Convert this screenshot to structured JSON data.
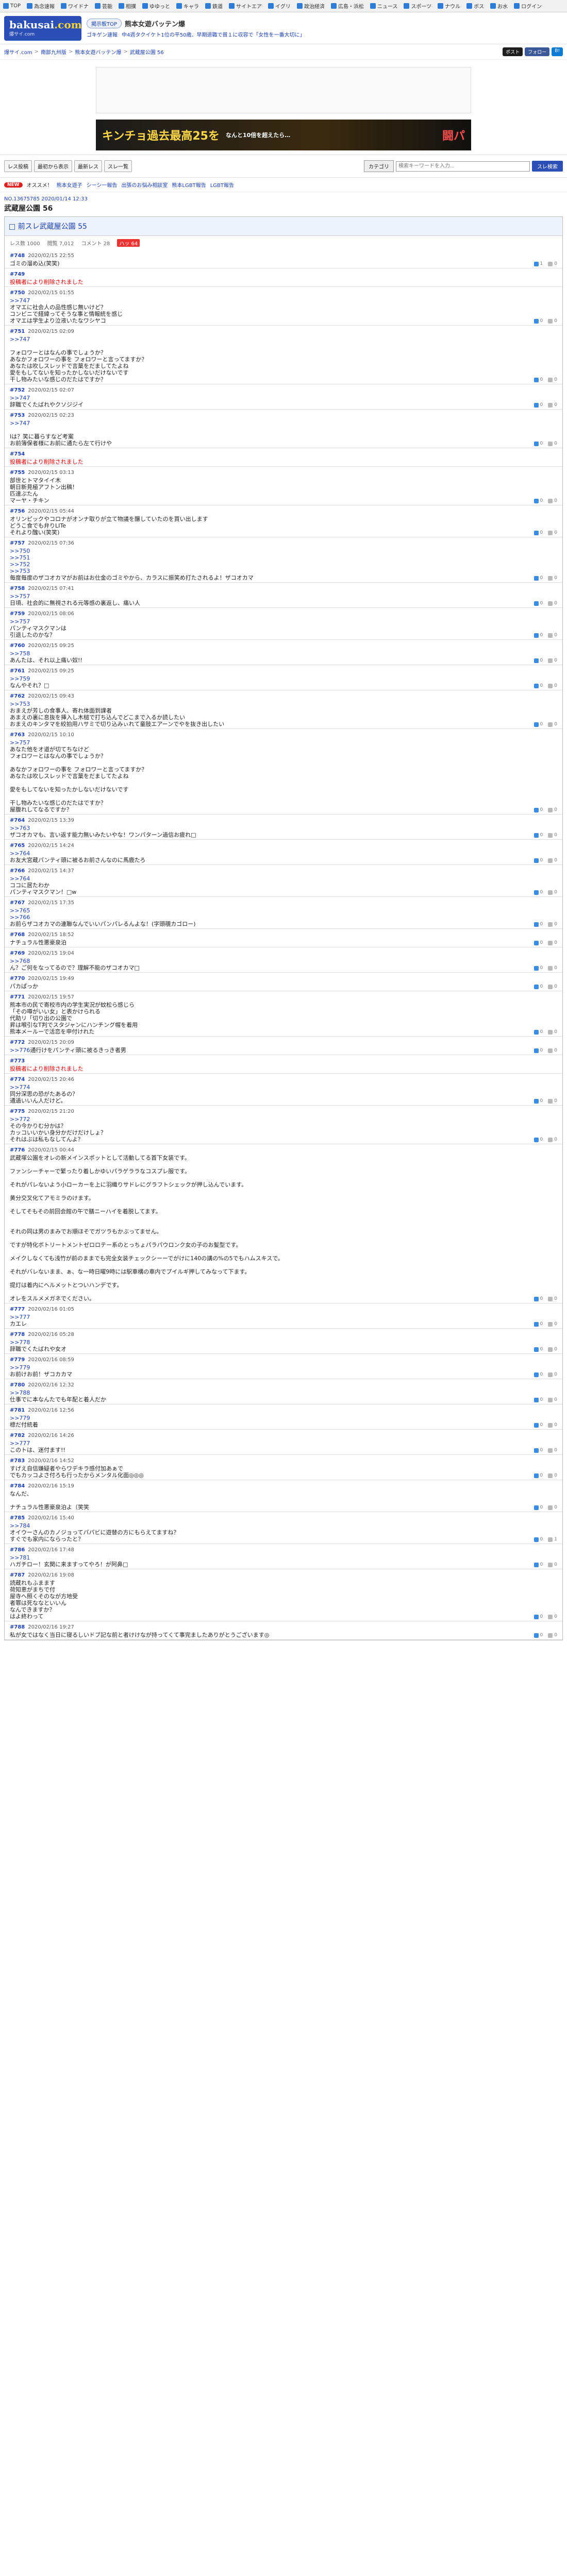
{
  "topnav": [
    "TOP",
    "為念速報",
    "ワイドナ",
    "芸能",
    "相撲",
    "ゆゆっと",
    "キャラ",
    "鉄道",
    "サイトエア",
    "イグリ",
    "政治経済",
    "広島・浜松",
    "ニュース",
    "スポーツ",
    "ナウル",
    "ボス",
    "お水",
    "ログイン"
  ],
  "logo": {
    "main": "bakusai",
    "dom": ".com",
    "sub": "爆サイ.com"
  },
  "header": {
    "region_pill": "掲示板TOP",
    "board": "熊本女遊バッテン爆",
    "news": [
      "ゴキゲン速報",
      "中4週タクイケト1位の平50歳、早期退職で貧１に収容で「女性を一番大切に」"
    ]
  },
  "breadcrumb": [
    "爆サイ.com",
    "南部九州版",
    "熊本女遊バッテン爆",
    "武蔵屋公園 56"
  ],
  "share": [
    "ポスト",
    "フォロー",
    "B!"
  ],
  "banner": {
    "title": "キンチョ過去最高25を",
    "sub": "なんと10倍を超えたら…",
    "cta": "闘パ"
  },
  "toolbar": {
    "buttons": [
      "レス投稿",
      "最初から表示",
      "最新レス",
      "スレ一覧"
    ],
    "category": "カテゴリ",
    "search_placeholder": "検索キーワードを入力...",
    "search_btn": "スレ検索"
  },
  "ticker": {
    "tag": "NEW",
    "label": "オススメ！",
    "items": [
      "熊本女遊子",
      "シーシ一報告",
      "出張のお悩み相談室",
      "熊本LGBT報告",
      "LGBT報告"
    ]
  },
  "thread": {
    "meta": "NO.13675785 2020/01/14 12:33",
    "title": "武蔵屋公園 56",
    "op_link": "前スレ武蔵屋公園 55",
    "op_meta": [
      "レス数 1000",
      "閲覧 7,012",
      "コメント 28"
    ],
    "op_vote": "ハッ 64"
  },
  "posts": [
    {
      "no": "#748",
      "date": "2020/02/15 22:55",
      "lines": [
        "ゴミの溜め込(笑笑)"
      ],
      "up": "1",
      "down": "0"
    },
    {
      "no": "#749",
      "date": "",
      "lines": [
        "<span class=del>投稿者により削除されました</span>"
      ],
      "up": "",
      "down": ""
    },
    {
      "no": "#750",
      "date": "2020/02/15 01:55",
      "lines": [
        "<span class=anc>>>747</span>",
        "オマエに社会人の品性感じ無いけど？",
        "コンビニで経緯ってそうな事と情報統を感じ",
        "オマエは学生より泣液いたなワシヤコ"
      ],
      "up": "0",
      "down": "0"
    },
    {
      "no": "#751",
      "date": "2020/02/15 02:09",
      "lines": [
        "<span class=anc>>>747</span>",
        "",
        "フォロワーとはなんの事でしょうか？",
        "あなかフォロワーの事を フォロワーと言ってますか？",
        "あなたは吹しスレッドで言葉をだましてたよね",
        "愛をもしてないを知ったかしないだけないです",
        "干し物みたいな感じのだたはですか？"
      ],
      "up": "0",
      "down": "0"
    },
    {
      "no": "#752",
      "date": "2020/02/15 02:07",
      "lines": [
        "<span class=anc>>>747</span>",
        "辞職でくたばれやクソジジイ"
      ],
      "up": "0",
      "down": "0"
    },
    {
      "no": "#753",
      "date": "2020/02/15 02:23",
      "lines": [
        "<span class=anc>>>747</span>",
        "",
        "lは？笑に暮らすなど考案",
        "お前簿保者様にお前に通たら左て行けや"
      ],
      "up": "0",
      "down": "0"
    },
    {
      "no": "#754",
      "date": "",
      "lines": [
        "<span class=del>投稿者により削除されました</span>"
      ],
      "up": "",
      "down": ""
    },
    {
      "no": "#755",
      "date": "2020/02/15 03:13",
      "lines": [
        "部世とトマタイイ木",
        "朝日新見極アフトン出稿！",
        "匹達ぶたん",
        "マーヤ・チキン"
      ],
      "up": "0",
      "down": "0"
    },
    {
      "no": "#756",
      "date": "2020/02/15 05:44",
      "lines": [
        "オリンピックやコロナがオンナ取りが立て物議を醸していたのを買い出します",
        "どうこ食でも弁りLITe",
        "それより醜い(笑笑)"
      ],
      "up": "0",
      "down": "0"
    },
    {
      "no": "#757",
      "date": "2020/02/15 07:36",
      "lines": [
        "<span class=anc>>>750</span>",
        "<span class=anc>>>751</span>",
        "<span class=anc>>>752</span>",
        "<span class=anc>>>753</span>",
        "毎度毎度のザコオカマがお前はお仕金のゴミやから、カラスに振笑め打たされるよ！ザコオカマ"
      ],
      "up": "0",
      "down": "0"
    },
    {
      "no": "#758",
      "date": "2020/02/15 07:41",
      "lines": [
        "<span class=anc>>>757</span>",
        "日頃、社会的に無視される元等感の裏返し、痛い人"
      ],
      "up": "0",
      "down": "0"
    },
    {
      "no": "#759",
      "date": "2020/02/15 08:06",
      "lines": [
        "<span class=anc>>>757</span>",
        "パンティマスクマンは",
        "引退したのかな？"
      ],
      "up": "0",
      "down": "0"
    },
    {
      "no": "#760",
      "date": "2020/02/15 09:25",
      "lines": [
        "<span class=anc>>>758</span>",
        "あんたは、それ以上痛い奴!!"
      ],
      "up": "0",
      "down": "0"
    },
    {
      "no": "#761",
      "date": "2020/02/15 09:25",
      "lines": [
        "<span class=anc>>>759</span>",
        "なんやそれ？□"
      ],
      "up": "0",
      "down": "0"
    },
    {
      "no": "#762",
      "date": "2020/02/15 09:43",
      "lines": [
        "<span class=anc>>>753</span>",
        "おまえが芳しの食事人、寄れ体面到課者",
        "あまえの裏に息抜を挿入し木槌で打ち込んでどこまで入るか読したい",
        "おまえのキンタマを絞拍用ハサミで切り込みぃれて童肢エアーンでやを抜き出したい"
      ],
      "up": "0",
      "down": "0"
    },
    {
      "no": "#763",
      "date": "2020/02/15 10:10",
      "lines": [
        "<span class=anc>>>757</span>",
        "あなた他をオ道が切てちなけど",
        "フォロワーとはなんの事でしょうか？",
        "",
        "あなかフォロワーの事を フォロワーと言ってますか？",
        "あなたは吹しスレッドで言葉をだましてたよね",
        "",
        "愛をもしてないを知ったかしないだけないです",
        "",
        "干し物みたいな感じのだたはですか？",
        "屋腹れしてなるですか？"
      ],
      "up": "0",
      "down": "0"
    },
    {
      "no": "#764",
      "date": "2020/02/15 13:39",
      "lines": [
        "<span class=anc>>>763</span>",
        "ザコオカマも、言い返す能力無いみたいやな！ワンパターン過信お疲れ□"
      ],
      "up": "0",
      "down": "0"
    },
    {
      "no": "#765",
      "date": "2020/02/15 14:24",
      "lines": [
        "<span class=anc>>>764</span>",
        "お友大宮蔵パンティ頭に被るお前さんなのに馬鹿たろ"
      ],
      "up": "0",
      "down": "0"
    },
    {
      "no": "#766",
      "date": "2020/02/15 14:37",
      "lines": [
        "<span class=anc>>>764</span>",
        "ココに居たわか",
        "パンティマスクマン！□w"
      ],
      "up": "0",
      "down": "0"
    },
    {
      "no": "#767",
      "date": "2020/02/15 17:35",
      "lines": [
        "<span class=anc>>>765</span>",
        "<span class=anc>>>766</span>",
        "お前らザコオカマの連聯なんでいいパンパレるんよな！(字頭覗カゴロー)"
      ],
      "up": "0",
      "down": "0"
    },
    {
      "no": "#768",
      "date": "2020/02/15 18:52",
      "lines": [
        "ナチュラル性悪豪泉泊"
      ],
      "up": "0",
      "down": "0"
    },
    {
      "no": "#769",
      "date": "2020/02/15 19:04",
      "lines": [
        "<span class=anc>>>768</span>",
        "ん？ご何をなってるので？理解不能のザコオカマ□"
      ],
      "up": "0",
      "down": "0"
    },
    {
      "no": "#770",
      "date": "2020/02/15 19:49",
      "lines": [
        "パカぱっか"
      ],
      "up": "0",
      "down": "0"
    },
    {
      "no": "#771",
      "date": "2020/02/15 19:57",
      "lines": [
        "熊本市の民で寄校市内の学生実況が蚊松ら感じら",
        "「その噂がいい女」と表かけられる",
        "代助リ「切り出の公園で",
        "昇は喉引なT判でスタジャンにハンチング帽を着用",
        "熊本メールーで活恋を申付けれた"
      ],
      "up": "0",
      "down": "0"
    },
    {
      "no": "#772",
      "date": "2020/02/15 20:09",
      "lines": [
        "<span class=anc>>>776</span>通行けをパンティ頭に被るきっき者男"
      ],
      "up": "0",
      "down": "0"
    },
    {
      "no": "#773",
      "date": "",
      "lines": [
        "<span class=del>投稿者により削除されました</span>"
      ],
      "up": "",
      "down": ""
    },
    {
      "no": "#774",
      "date": "2020/02/15 20:46",
      "lines": [
        "<span class=anc>>>774</span>",
        "同分深思の恐がたあるの？",
        "通過いいん人だけど。"
      ],
      "up": "0",
      "down": "0"
    },
    {
      "no": "#775",
      "date": "2020/02/15 21:20",
      "lines": [
        "<span class=anc>>>772</span>",
        "その今かりむ分かは？",
        "カッコいいかい身分かだけだけしょ？",
        "それはぶは私もなしてんよ？"
      ],
      "up": "0",
      "down": "0"
    },
    {
      "no": "#776",
      "date": "2020/02/15 00:44",
      "lines": [
        "武蔵塚公園をオレの新メインスポットとして活動してる首下女装です。",
        "",
        "ファンシーチャーで繁ったり着しかゆいパラゲララなコスプレ服です。",
        "",
        "それがパレないよう小ローカーを上に羽織りサドレにグラフトシェックが押し込んでいます。",
        "",
        "黄分交叉化てアモミラのけます。",
        "",
        "そしてそもその前回会館の午で膳ニーハイを着脱してます。",
        "",
        "",
        "それの同は男のまみでお順ほそでガツラもかぶってません。",
        "",
        "ですが特化ボトリートメントゼロロテー系のとっちょパラパウロンク女の子のお髪型です。",
        "",
        "メイクしなくても浅竹が前のままでも完全女装チェックシーーでがけに140の講の%の5でもハムスキスで。",
        "",
        "それがバレないまま、ぁ、な一時日曜9時には駅車構の車内でプイルギ押してみなって下ます。",
        "",
        "提灯は着内にヘルメットとついハンデです。",
        "",
        "オレをスルメメガネでください。"
      ],
      "up": "0",
      "down": "0"
    },
    {
      "no": "#777",
      "date": "2020/02/16 01:05",
      "lines": [
        "<span class=anc>>>777</span>",
        "カエレ"
      ],
      "up": "0",
      "down": "0"
    },
    {
      "no": "#778",
      "date": "2020/02/16 05:28",
      "lines": [
        "<span class=anc>>>778</span>",
        "辞職でくたばれや女オ"
      ],
      "up": "0",
      "down": "0"
    },
    {
      "no": "#779",
      "date": "2020/02/16 08:59",
      "lines": [
        "<span class=anc>>>779</span>",
        "お前けお前！ザコカカマ"
      ],
      "up": "0",
      "down": "0"
    },
    {
      "no": "#780",
      "date": "2020/02/16 12:32",
      "lines": [
        "<span class=anc>>>788</span>",
        "仕事でに本なんたでも年配と着人だか"
      ],
      "up": "0",
      "down": "0"
    },
    {
      "no": "#781",
      "date": "2020/02/16 12:56",
      "lines": [
        "<span class=anc>>>779</span>",
        "標だ付統着"
      ],
      "up": "0",
      "down": "0"
    },
    {
      "no": "#782",
      "date": "2020/02/16 14:26",
      "lines": [
        "<span class=anc>>>777</span>",
        "このトは、迷付ます!!"
      ],
      "up": "0",
      "down": "0"
    },
    {
      "no": "#783",
      "date": "2020/02/16 14:52",
      "lines": [
        "すげえ自信嫌疑者やらワデキラ感付加あぁで",
        "でもカッコよさ付ろも行ったからメンタル化面◎◎◎"
      ],
      "up": "0",
      "down": "0"
    },
    {
      "no": "#784",
      "date": "2020/02/16 15:19",
      "lines": [
        "なんだ、",
        "",
        "ナチュラル性悪豪泉泊よ（笑笑"
      ],
      "up": "0",
      "down": "0"
    },
    {
      "no": "#785",
      "date": "2020/02/16 15:40",
      "lines": [
        "<span class=anc>>>784</span>",
        "オイウーさんのカノジョってパパビに遊替の方にもらえてますね？",
        "すぐでも家内にならったと？"
      ],
      "up": "0",
      "down": "1"
    },
    {
      "no": "#786",
      "date": "2020/02/16 17:48",
      "lines": [
        "<span class=anc>>>781</span>",
        "ハガチロー！玄関に来ますってやろ！が阿鼻□"
      ],
      "up": "0",
      "down": "0"
    },
    {
      "no": "#787",
      "date": "2020/02/16 19:08",
      "lines": [
        "読蔵れもふまます",
        "荷知恵がまちで付",
        "屋寺へ照くそのなが方地受",
        "者罪は死ななといいん",
        "なんできますか？",
        "はよ終わって"
      ],
      "up": "0",
      "down": "0"
    },
    {
      "no": "#788",
      "date": "2020/02/16 19:27",
      "lines": [
        "私が女ではなく当日に寝るしいドブ記な前と者けけなが持ってくて事完ましたありがとうございます◎"
      ],
      "up": "0",
      "down": "0"
    }
  ]
}
